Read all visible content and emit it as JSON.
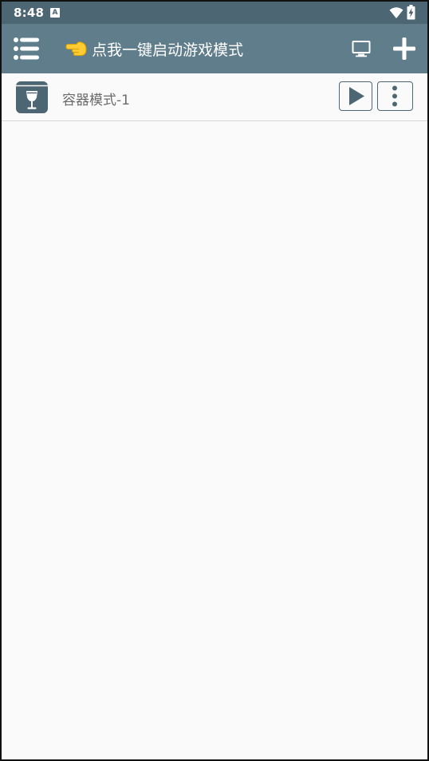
{
  "status_bar": {
    "time": "8:48",
    "notification_letter": "A",
    "icons": [
      "notification-a-icon",
      "wifi-icon",
      "battery-charging-icon"
    ]
  },
  "toolbar": {
    "title": "点我一键启动游戏模式",
    "title_emoji_icon": "pointing-hand-icon",
    "menu_icon": "menu-list-icon",
    "display_icon": "monitor-icon",
    "add_icon": "plus-icon",
    "background_color": "#607d8b",
    "status_bar_color": "#4d6673"
  },
  "containers": [
    {
      "name": "容器模式-1",
      "icon": "wine-glass-box-icon",
      "actions": [
        "play-icon",
        "more-vertical-icon"
      ]
    }
  ]
}
